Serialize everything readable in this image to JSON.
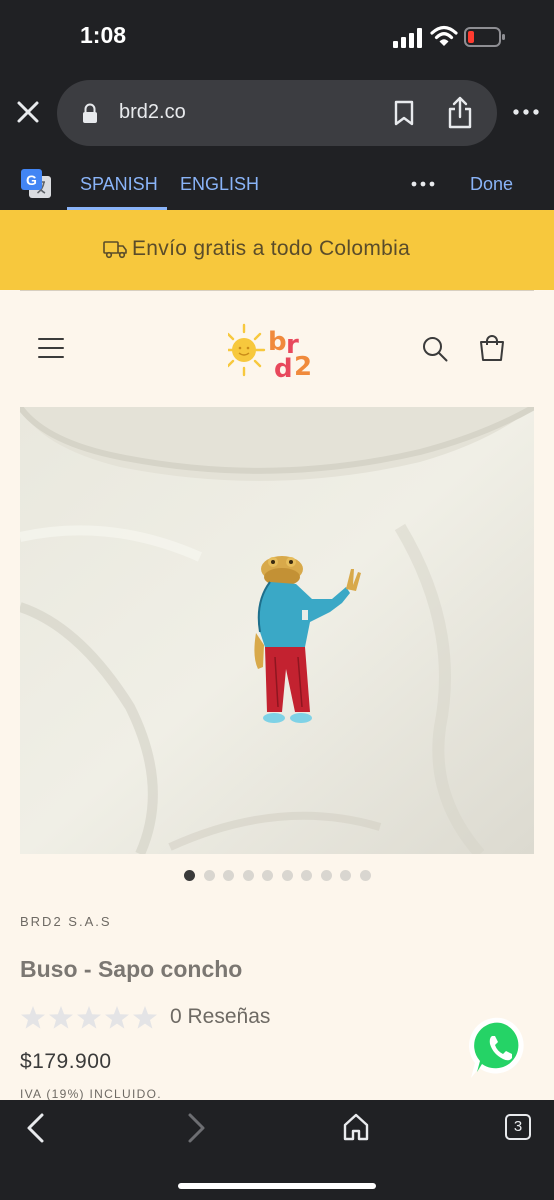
{
  "status_bar": {
    "time": "1:08"
  },
  "browser": {
    "url": "brd2.co",
    "translate": {
      "tabs": [
        "SPANISH",
        "ENGLISH"
      ],
      "done_label": "Done"
    },
    "open_tab_count": "3"
  },
  "store": {
    "announcement": "Envío gratis a todo Colombia",
    "logo_text": "brd2",
    "image_slider": {
      "total_images": 10,
      "current_index": 0
    },
    "product": {
      "vendor": "BRD2 S.A.S",
      "title": "Buso - Sapo concho",
      "rating": 0,
      "rating_max": 5,
      "review_count_label": "0 Reseñas",
      "price": "$179.900",
      "tax_note": "IVA (19%) INCLUIDO."
    }
  },
  "colors": {
    "announcement_bg": "#f7c83d",
    "page_bg": "#fdf6ec",
    "browser_chrome": "#202124",
    "link_blue": "#8ab4f8",
    "whatsapp_green": "#25d366"
  }
}
